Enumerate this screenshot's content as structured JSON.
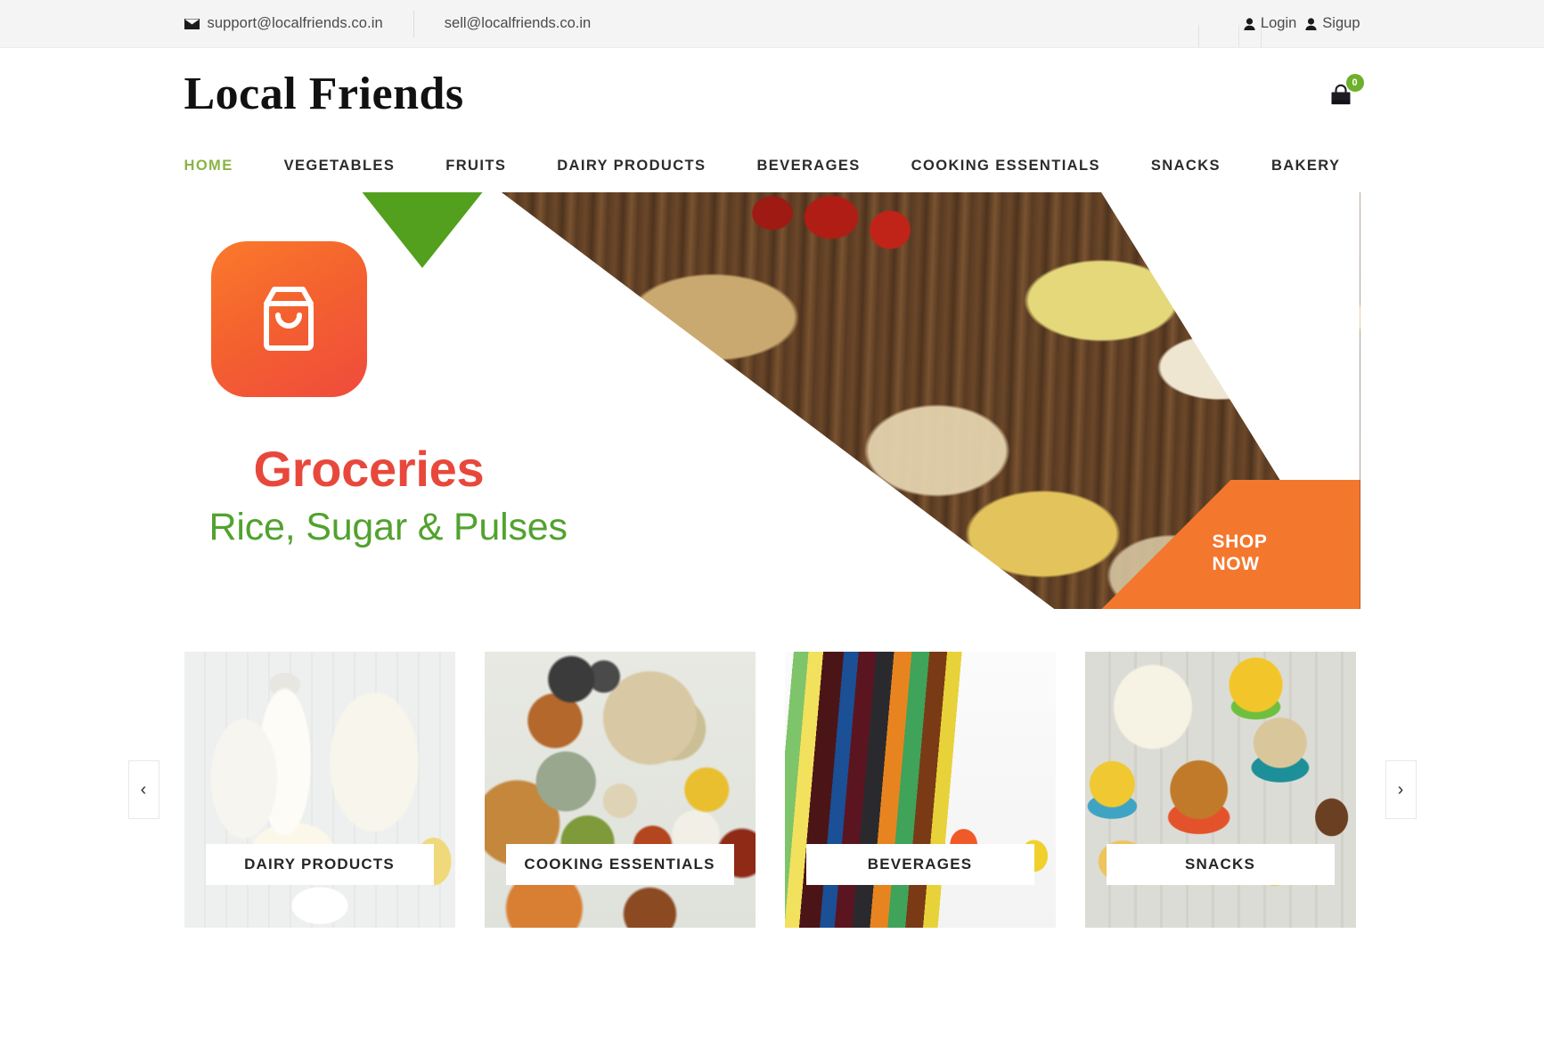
{
  "topbar": {
    "support_email": "support@localfriends.co.in",
    "sell_email": "sell@localfriends.co.in",
    "login_label": "Login",
    "signup_label": "Sigup",
    "mail_icon": "envelope-icon",
    "user_icon": "user-icon"
  },
  "header": {
    "brand": "Local Friends",
    "cart_icon": "shopping-bag-icon",
    "cart_count": "0",
    "cart_badge_color": "#6cb02c"
  },
  "nav": {
    "items": [
      {
        "label": "HOME",
        "active": true
      },
      {
        "label": "VEGETABLES",
        "active": false
      },
      {
        "label": "FRUITS",
        "active": false
      },
      {
        "label": "DAIRY PRODUCTS",
        "active": false
      },
      {
        "label": "BEVERAGES",
        "active": false
      },
      {
        "label": "COOKING ESSENTIALS",
        "active": false
      },
      {
        "label": "SNACKS",
        "active": false
      },
      {
        "label": "BAKERY",
        "active": false
      }
    ],
    "active_color": "#8ab446",
    "inactive_color": "#2b2b2b"
  },
  "hero": {
    "app_icon": "shopping-bag-app-icon",
    "title": "Groceries",
    "title_color": "#e8483c",
    "subtitle": "Rice, Sugar & Pulses",
    "subtitle_color": "#52a22f",
    "cta_line1": "SHOP",
    "cta_line2": "NOW",
    "cta_color": "#f4772e",
    "accent_triangle_color": "#52a01e"
  },
  "carousel": {
    "prev_icon": "chevron-left-icon",
    "prev_label": "‹",
    "next_icon": "chevron-right-icon",
    "next_label": "›",
    "cards": [
      {
        "label": "DAIRY PRODUCTS",
        "image": "dairy-products-photo"
      },
      {
        "label": "COOKING ESSENTIALS",
        "image": "cooking-essentials-photo"
      },
      {
        "label": "BEVERAGES",
        "image": "beverages-photo"
      },
      {
        "label": "SNACKS",
        "image": "snacks-photo"
      }
    ]
  }
}
